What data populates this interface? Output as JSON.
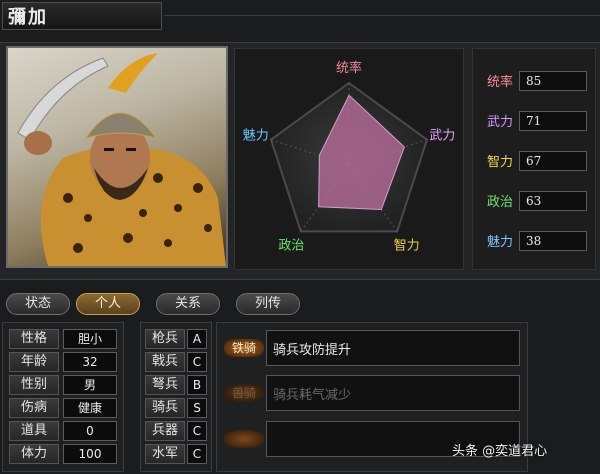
{
  "character": {
    "name": "彌加"
  },
  "radar": {
    "axes": [
      "统率",
      "武力",
      "智力",
      "政治",
      "魅力"
    ],
    "axis_colors": [
      "#f08aa0",
      "#e0a6ff",
      "#f0d040",
      "#70e070",
      "#70c8ff"
    ],
    "max": 100
  },
  "stats": [
    {
      "label": "统率",
      "value": 85,
      "color": "#ff8a9a"
    },
    {
      "label": "武力",
      "value": 71,
      "color": "#d59cff"
    },
    {
      "label": "智力",
      "value": 67,
      "color": "#f5d84a"
    },
    {
      "label": "政治",
      "value": 63,
      "color": "#7ae07a"
    },
    {
      "label": "魅力",
      "value": 38,
      "color": "#7ac8ff"
    }
  ],
  "tabs": [
    {
      "label": "状态",
      "active": false
    },
    {
      "label": "个人",
      "active": true
    },
    {
      "label": "关系",
      "active": false
    },
    {
      "label": "列传",
      "active": false
    }
  ],
  "personal": [
    {
      "label": "性格",
      "value": "胆小"
    },
    {
      "label": "年龄",
      "value": "32"
    },
    {
      "label": "性别",
      "value": "男"
    },
    {
      "label": "伤病",
      "value": "健康"
    },
    {
      "label": "道具",
      "value": "0"
    },
    {
      "label": "体力",
      "value": "100"
    }
  ],
  "aptitude": [
    {
      "label": "枪兵",
      "grade": "A"
    },
    {
      "label": "戟兵",
      "grade": "C"
    },
    {
      "label": "弩兵",
      "grade": "B"
    },
    {
      "label": "骑兵",
      "grade": "S"
    },
    {
      "label": "兵器",
      "grade": "C"
    },
    {
      "label": "水军",
      "grade": "C"
    }
  ],
  "skills": [
    {
      "tag": "铁骑",
      "desc": "骑兵攻防提升",
      "active": true
    },
    {
      "tag": "兽骑",
      "desc": "骑兵耗气减少",
      "active": false
    },
    {
      "tag": "",
      "desc": "",
      "active": false
    }
  ],
  "watermark": "头条 @奕道君心"
}
